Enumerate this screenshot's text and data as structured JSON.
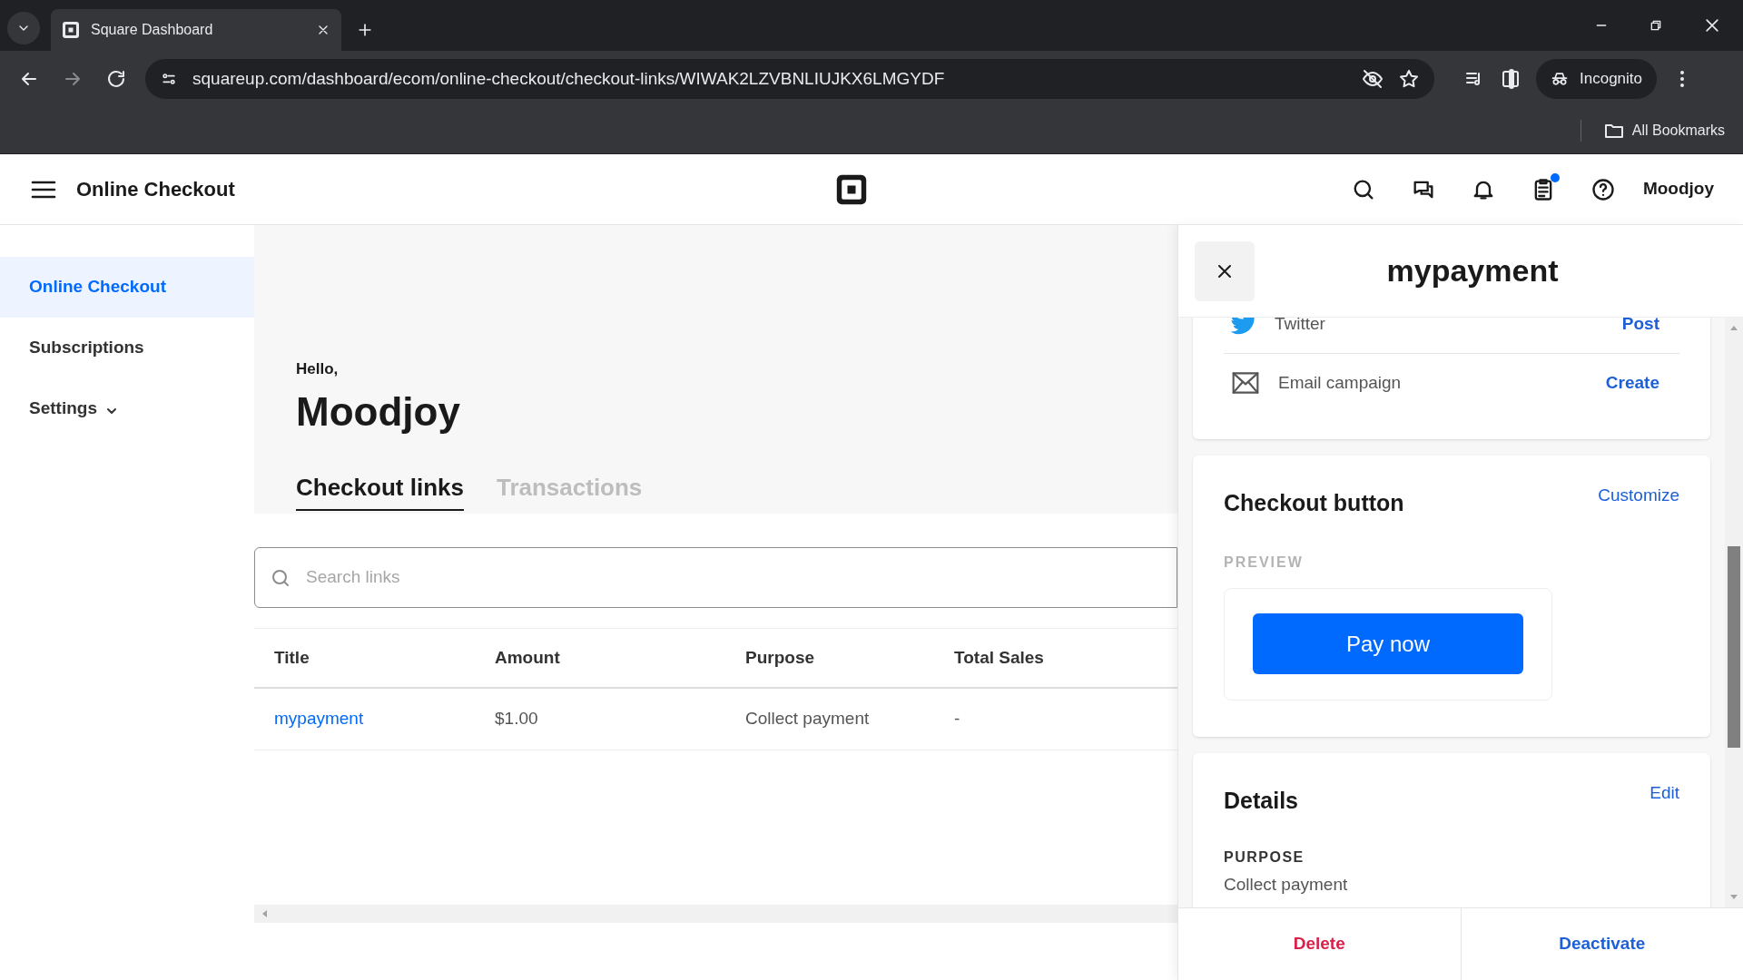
{
  "browser": {
    "tab_title": "Square Dashboard",
    "url": "squareup.com/dashboard/ecom/online-checkout/checkout-links/WIWAK2LZVBNLIUJKX6LMGYDF",
    "profile": "Incognito",
    "bookmarks": "All Bookmarks"
  },
  "header": {
    "title": "Online Checkout",
    "user": "Moodjoy",
    "notification_dot": true
  },
  "sidebar": {
    "items": [
      {
        "label": "Online Checkout",
        "selected": true,
        "has_menu": false
      },
      {
        "label": "Subscriptions",
        "selected": false,
        "has_menu": false
      },
      {
        "label": "Settings",
        "selected": false,
        "has_menu": true
      }
    ]
  },
  "main": {
    "greeting": "Hello,",
    "name": "Moodjoy",
    "tabs": [
      {
        "label": "Checkout links",
        "selected": true
      },
      {
        "label": "Transactions",
        "selected": false
      }
    ],
    "search": {
      "placeholder": "Search links"
    },
    "table": {
      "columns": [
        "Title",
        "Amount",
        "Purpose",
        "Total Sales"
      ],
      "rows": [
        [
          "mypayment",
          "$1.00",
          "Collect payment",
          "-"
        ]
      ]
    }
  },
  "panel": {
    "title": "mypayment",
    "share_rows": [
      {
        "kind": "twitter",
        "label": "Twitter",
        "action": "Post"
      },
      {
        "kind": "email",
        "label": "Email campaign",
        "action": "Create"
      }
    ],
    "checkout_button": {
      "title": "Checkout button",
      "action": "Customize",
      "preview_label": "PREVIEW",
      "button_label": "Pay now"
    },
    "details": {
      "title": "Details",
      "action": "Edit",
      "fields": [
        {
          "label": "PURPOSE",
          "value": "Collect payment"
        }
      ]
    },
    "footer": [
      {
        "label": "Delete",
        "kind": "danger"
      },
      {
        "label": "Deactivate",
        "kind": "primary"
      }
    ]
  }
}
